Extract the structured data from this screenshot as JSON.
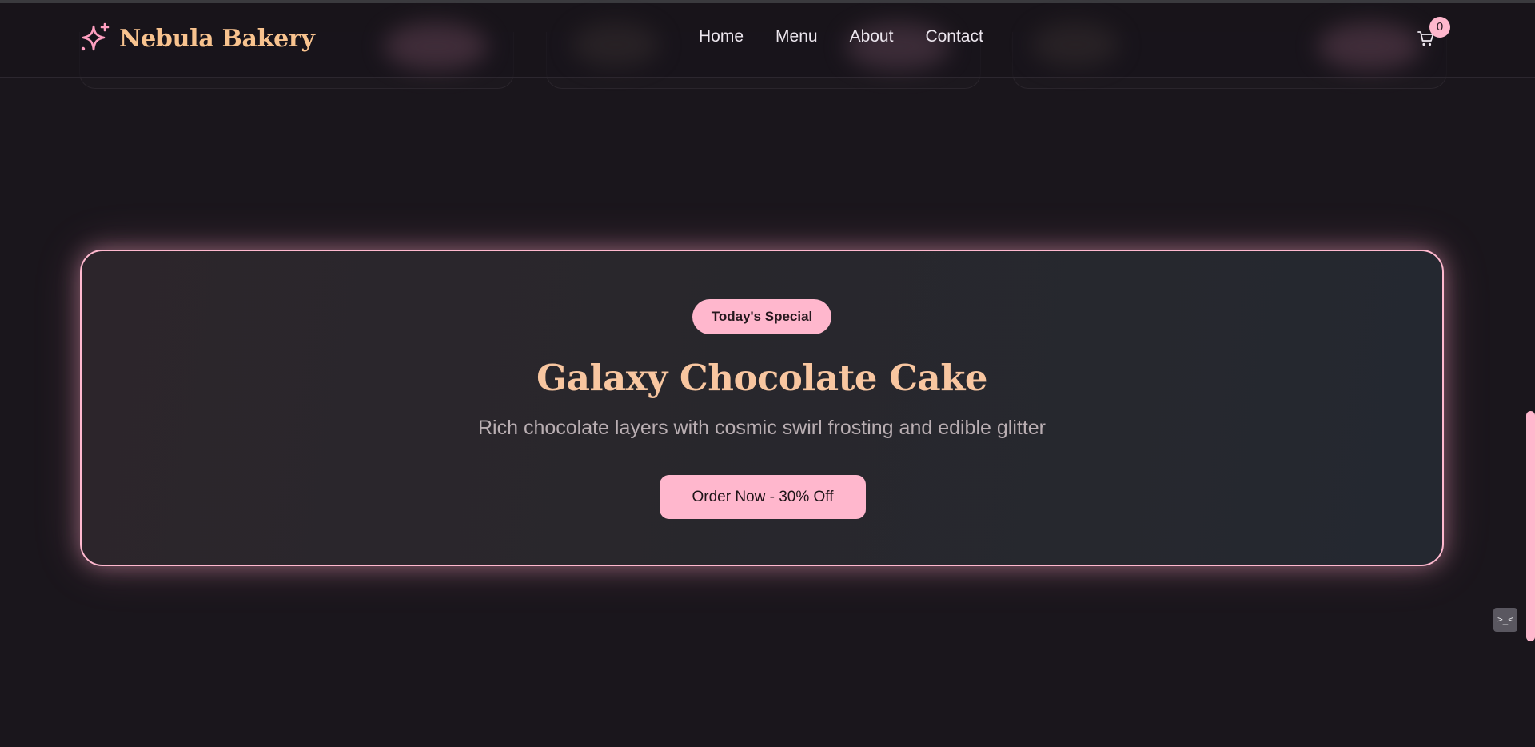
{
  "header": {
    "brand": "Nebula Bakery",
    "logo_icon": "sparkle-icon",
    "nav": [
      {
        "label": "Home"
      },
      {
        "label": "Menu"
      },
      {
        "label": "About"
      },
      {
        "label": "Contact"
      }
    ],
    "cart_icon": "cart-icon",
    "cart_count": "0"
  },
  "special": {
    "badge": "Today's Special",
    "title": "Galaxy Chocolate Cake",
    "description": "Rich chocolate layers with cosmic swirl frosting and edible glitter",
    "cta": "Order Now - 30% Off"
  },
  "dev_widget": {
    "glyph": ">_<"
  },
  "colors": {
    "accent_pink": "#ffb7cd",
    "title_peach": "#f8c6a0",
    "brand_gold": "#f8c38f",
    "background": "#1a161c"
  }
}
